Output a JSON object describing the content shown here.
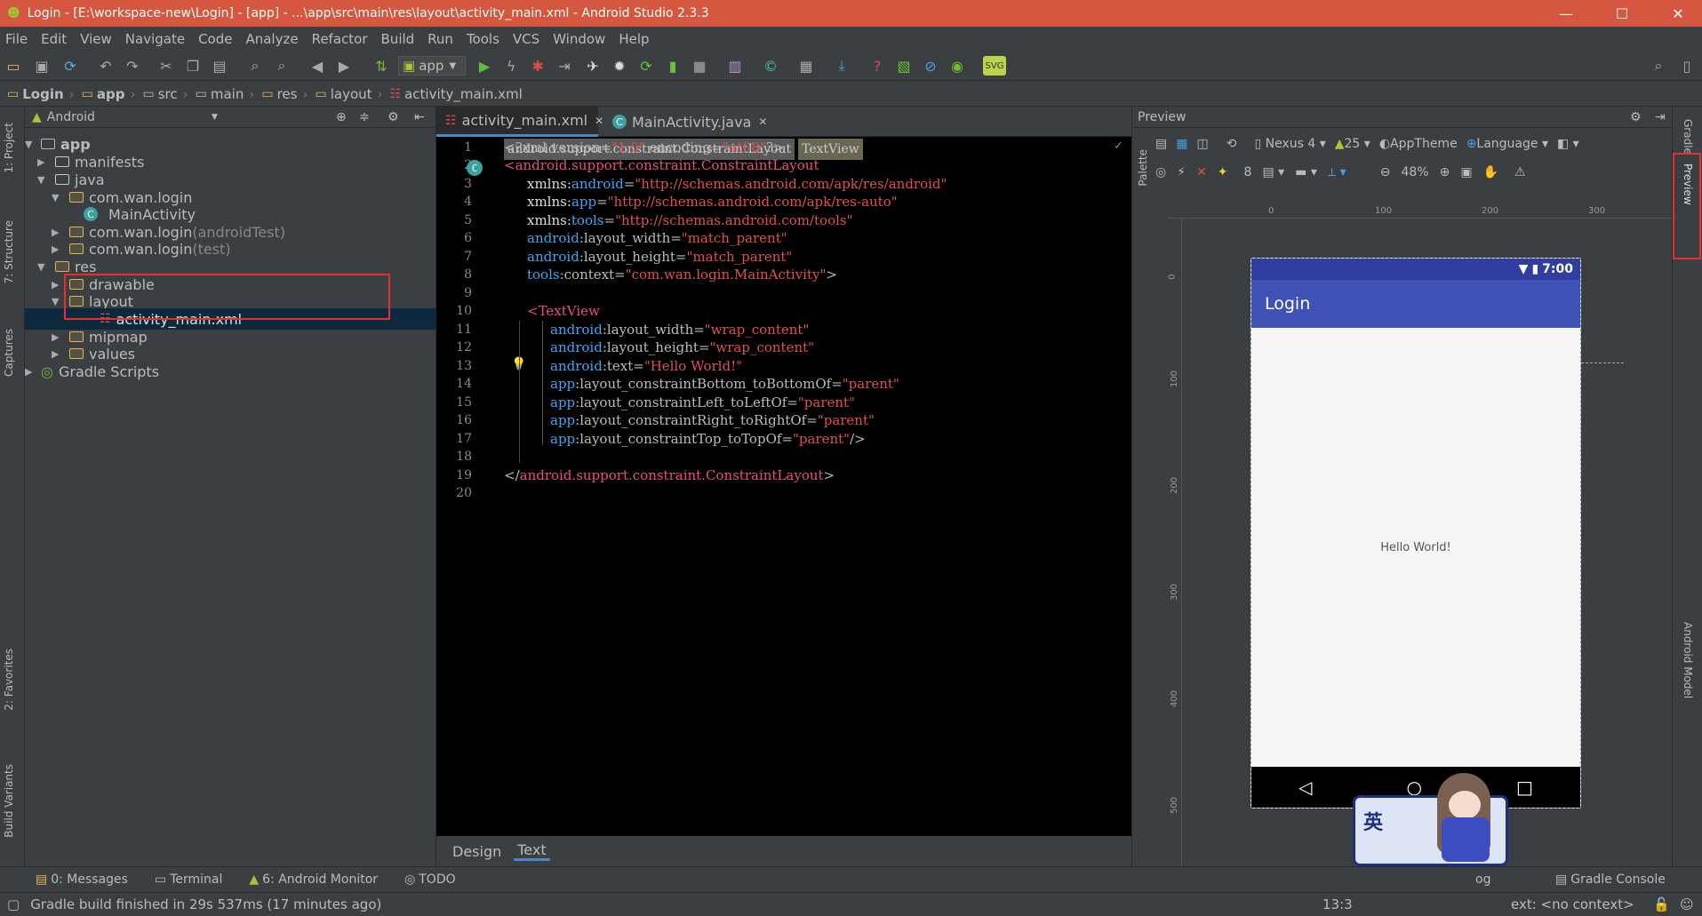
{
  "window": {
    "title": "Login - [E:\\workspace-new\\Login] - [app] - ...\\app\\src\\main\\res\\layout\\activity_main.xml - Android Studio 2.3.3"
  },
  "menu": [
    "File",
    "Edit",
    "View",
    "Navigate",
    "Code",
    "Analyze",
    "Refactor",
    "Build",
    "Run",
    "Tools",
    "VCS",
    "Window",
    "Help"
  ],
  "toolbar": {
    "run_config": "app",
    "svg_label": "SVG"
  },
  "breadcrumb": [
    "Login",
    "app",
    "src",
    "main",
    "res",
    "layout",
    "activity_main.xml"
  ],
  "left_tools": [
    "1: Project",
    "7: Structure",
    "Captures",
    "2: Favorites",
    "Build Variants"
  ],
  "project": {
    "view_mode": "Android",
    "tree": [
      {
        "label": "app",
        "suffix": ""
      },
      {
        "label": "manifests",
        "suffix": ""
      },
      {
        "label": "java",
        "suffix": ""
      },
      {
        "label": "com.wan.login",
        "suffix": ""
      },
      {
        "label": "MainActivity",
        "suffix": ""
      },
      {
        "label": "com.wan.login",
        "suffix": " (androidTest)"
      },
      {
        "label": "com.wan.login",
        "suffix": " (test)"
      },
      {
        "label": "res",
        "suffix": ""
      },
      {
        "label": "drawable",
        "suffix": ""
      },
      {
        "label": "layout",
        "suffix": ""
      },
      {
        "label": "activity_main.xml",
        "suffix": ""
      },
      {
        "label": "mipmap",
        "suffix": ""
      },
      {
        "label": "values",
        "suffix": ""
      },
      {
        "label": "Gradle Scripts",
        "suffix": ""
      }
    ]
  },
  "editor": {
    "tabs": [
      "activity_main.xml",
      "MainActivity.java"
    ],
    "tags": [
      "android.support.constraint.ConstraintLayout",
      "TextView"
    ],
    "line_numbers": [
      "1",
      "2",
      "3",
      "4",
      "5",
      "6",
      "7",
      "8",
      "9",
      "10",
      "11",
      "12",
      "13",
      "14",
      "15",
      "16",
      "17",
      "18",
      "19",
      "20"
    ],
    "bottom_tabs": [
      "Design",
      "Text"
    ]
  },
  "preview": {
    "title": "Preview",
    "device": "Nexus 4",
    "api": "25",
    "theme": "AppTheme",
    "language": "Language",
    "zoom": "48%",
    "margin": "8",
    "ruler_top": [
      "0",
      "100",
      "200",
      "300"
    ],
    "ruler_left": [
      "0",
      "100",
      "200",
      "300",
      "400",
      "500"
    ],
    "phone": {
      "time": "7:00",
      "app_title": "Login",
      "body_text": "Hello World!"
    },
    "palette": "Palette"
  },
  "right_tools": [
    "Gradle",
    "Preview",
    "Android Model"
  ],
  "bottom_tools": [
    "0: Messages",
    "Terminal",
    "6: Android Monitor",
    "TODO",
    "og",
    "Gradle Console"
  ],
  "status": {
    "message": "Gradle build finished in 29s 537ms (17 minutes ago)",
    "position": "13:3",
    "context": "ext: <no context>"
  },
  "ime": {
    "lang": "英"
  },
  "colors": {
    "titlebar": "#d5573f",
    "accent": "#3f51b5",
    "editor_bg": "#000000"
  }
}
